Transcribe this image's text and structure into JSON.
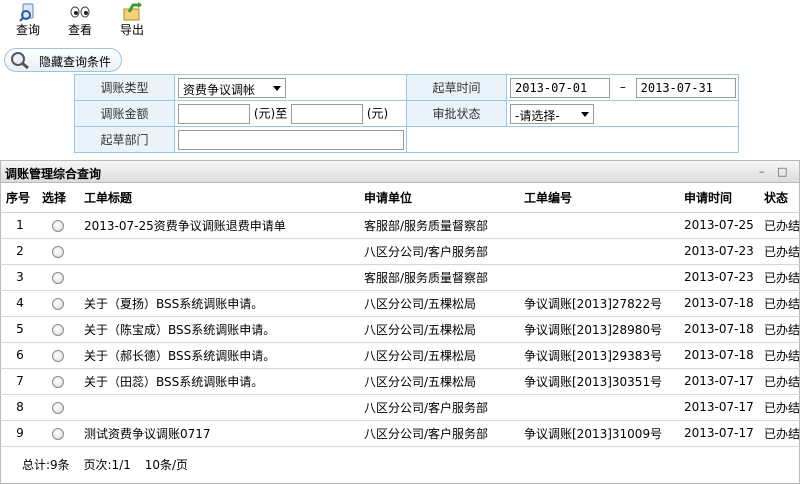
{
  "toolbar": {
    "query": "查询",
    "view": "查看",
    "export": "导出"
  },
  "toggle_label": "隐藏查询条件",
  "form": {
    "type_label": "调账类型",
    "type_value": "资费争议调帐",
    "draft_time_label": "起草时间",
    "date_from": "2013-07-01",
    "date_sep": "–",
    "date_to": "2013-07-31",
    "amount_label": "调账金额",
    "yuan_to": "(元)至",
    "yuan": "(元)",
    "approval_label": "审批状态",
    "approval_value": "-请选择-",
    "dept_label": "起草部门"
  },
  "panel": {
    "title": "调账管理综合查询",
    "min": "–",
    "max": "□"
  },
  "table": {
    "headers": [
      "序号",
      "选择",
      "工单标题",
      "申请单位",
      "工单编号",
      "申请时间",
      "状态"
    ],
    "rows": [
      {
        "no": "1",
        "title": "2013-07-25资费争议调账退费申请单",
        "unit": "客服部/服务质量督察部",
        "code": "",
        "time": "2013-07-25",
        "status": "已办结"
      },
      {
        "no": "2",
        "title": "",
        "unit": "八区分公司/客户服务部",
        "code": "",
        "time": "2013-07-23",
        "status": "已办结"
      },
      {
        "no": "3",
        "title": "",
        "unit": "客服部/服务质量督察部",
        "code": "",
        "time": "2013-07-23",
        "status": "已办结"
      },
      {
        "no": "4",
        "title": "关于（夏扬）BSS系统调账申请。",
        "unit": "八区分公司/五棵松局",
        "code": "争议调账[2013]27822号",
        "time": "2013-07-18",
        "status": "已办结"
      },
      {
        "no": "5",
        "title": "关于（陈宝成）BSS系统调账申请。",
        "unit": "八区分公司/五棵松局",
        "code": "争议调账[2013]28980号",
        "time": "2013-07-18",
        "status": "已办结"
      },
      {
        "no": "6",
        "title": "关于（郝长德）BSS系统调账申请。",
        "unit": "八区分公司/五棵松局",
        "code": "争议调账[2013]29383号",
        "time": "2013-07-18",
        "status": "已办结"
      },
      {
        "no": "7",
        "title": "关于（田蕊）BSS系统调账申请。",
        "unit": "八区分公司/五棵松局",
        "code": "争议调账[2013]30351号",
        "time": "2013-07-17",
        "status": "已办结"
      },
      {
        "no": "8",
        "title": "",
        "unit": "八区分公司/客户服务部",
        "code": "",
        "time": "2013-07-17",
        "status": "已办结"
      },
      {
        "no": "9",
        "title": "测试资费争议调账0717",
        "unit": "八区分公司/客户服务部",
        "code": "争议调账[2013]31009号",
        "time": "2013-07-17",
        "status": "已办结"
      }
    ]
  },
  "footer": {
    "total": "总计:9条",
    "page": "页次:1/1",
    "per_page": "10条/页"
  }
}
